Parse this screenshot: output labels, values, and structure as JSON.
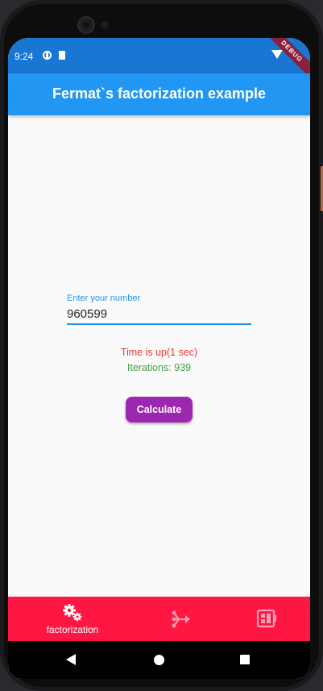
{
  "status_bar": {
    "time": "9:24",
    "debug_label": "DEBUG"
  },
  "app_bar": {
    "title": "Fermat`s factorization example"
  },
  "form": {
    "label": "Enter your number",
    "value": "960599"
  },
  "result": {
    "time_text": "Time is up(1 sec)",
    "iterations_text": "Iterations: 939"
  },
  "calculate_button": {
    "label": "Calculate"
  },
  "bottom_nav": {
    "items": [
      {
        "label": "factorization",
        "icon": "gears-icon",
        "selected": true
      },
      {
        "label": "",
        "icon": "tree-branch-icon",
        "selected": false
      },
      {
        "label": "",
        "icon": "dashboard-icon",
        "selected": false
      }
    ]
  },
  "colors": {
    "status_bar": "#1976d2",
    "app_bar": "#2196f3",
    "accent": "#2196f3",
    "error_text": "#e53935",
    "success_text": "#43a047",
    "button": "#9c27b0",
    "bottom_nav": "#ff1744"
  }
}
